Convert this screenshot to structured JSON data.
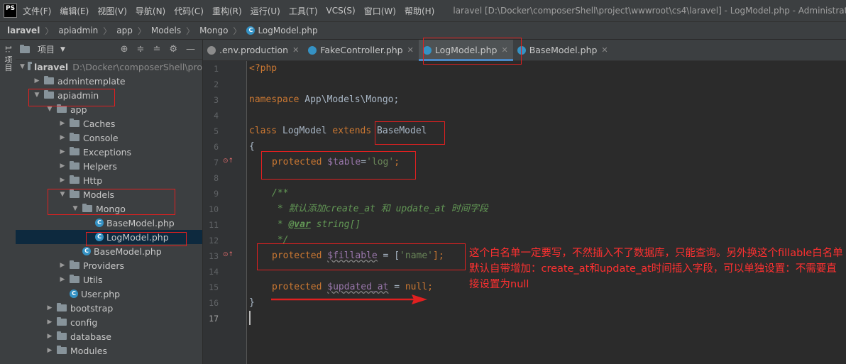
{
  "menubar": {
    "logo": "PS",
    "items": [
      "文件(F)",
      "编辑(E)",
      "视图(V)",
      "导航(N)",
      "代码(C)",
      "重构(R)",
      "运行(U)",
      "工具(T)",
      "VCS(S)",
      "窗口(W)",
      "帮助(H)"
    ],
    "window_title": "laravel [D:\\Docker\\composerShell\\project\\wwwroot\\cs4\\laravel] - LogModel.php - Administrator"
  },
  "breadcrumb": [
    "laravel",
    "apiadmin",
    "app",
    "Models",
    "Mongo",
    "LogModel.php"
  ],
  "left_strip": {
    "tab_label": "1: 项目"
  },
  "project_panel": {
    "title": "项目",
    "root": {
      "name": "laravel",
      "path": "D:\\Docker\\composerShell\\pro"
    },
    "tree": [
      {
        "label": "admintemplate",
        "depth": 1,
        "type": "folder",
        "expanded": false
      },
      {
        "label": "apiadmin",
        "depth": 1,
        "type": "folder",
        "expanded": true
      },
      {
        "label": "app",
        "depth": 2,
        "type": "folder",
        "expanded": true
      },
      {
        "label": "Caches",
        "depth": 3,
        "type": "folder",
        "expanded": false
      },
      {
        "label": "Console",
        "depth": 3,
        "type": "folder",
        "expanded": false
      },
      {
        "label": "Exceptions",
        "depth": 3,
        "type": "folder",
        "expanded": false
      },
      {
        "label": "Helpers",
        "depth": 3,
        "type": "folder",
        "expanded": false
      },
      {
        "label": "Http",
        "depth": 3,
        "type": "folder",
        "expanded": false
      },
      {
        "label": "Models",
        "depth": 3,
        "type": "folder",
        "expanded": true
      },
      {
        "label": "Mongo",
        "depth": 4,
        "type": "folder",
        "expanded": true
      },
      {
        "label": "BaseModel.php",
        "depth": 5,
        "type": "php"
      },
      {
        "label": "LogModel.php",
        "depth": 5,
        "type": "php",
        "selected": true
      },
      {
        "label": "BaseModel.php",
        "depth": 4,
        "type": "php"
      },
      {
        "label": "Providers",
        "depth": 3,
        "type": "folder",
        "expanded": false
      },
      {
        "label": "Utils",
        "depth": 3,
        "type": "folder",
        "expanded": false
      },
      {
        "label": "User.php",
        "depth": 3,
        "type": "php"
      },
      {
        "label": "bootstrap",
        "depth": 2,
        "type": "folder",
        "expanded": false
      },
      {
        "label": "config",
        "depth": 2,
        "type": "folder",
        "expanded": false
      },
      {
        "label": "database",
        "depth": 2,
        "type": "folder",
        "expanded": false
      },
      {
        "label": "Modules",
        "depth": 2,
        "type": "folder",
        "expanded": false
      }
    ]
  },
  "tabs": [
    {
      "label": ".env.production",
      "icon": "env-file-icon",
      "icon_color": "#8c8c8c"
    },
    {
      "label": "FakeController.php",
      "icon": "php-class-icon",
      "icon_color": "#3592c4"
    },
    {
      "label": "LogModel.php",
      "icon": "php-class-icon",
      "icon_color": "#3592c4",
      "active": true
    },
    {
      "label": "BaseModel.php",
      "icon": "php-class-icon",
      "icon_color": "#3592c4"
    }
  ],
  "code": {
    "line_numbers": [
      "1",
      "2",
      "3",
      "4",
      "5",
      "6",
      "7",
      "8",
      "9",
      "10",
      "11",
      "12",
      "13",
      "14",
      "15",
      "16",
      "17"
    ],
    "l1": "<?php",
    "l3_kw": "namespace",
    "l3_rest": " App\\Models\\Mongo;",
    "l5_kw1": "class",
    "l5_name": " LogModel ",
    "l5_kw2": "extends",
    "l5_parent": " BaseModel",
    "l6": "{",
    "l7_kw": "protected",
    "l7_var": "$table",
    "l7_eq": "=",
    "l7_str": "'log'",
    "l7_end": ";",
    "l9": "/**",
    "l10_a": " * 默认添加",
    "l10_b": "create_at",
    "l10_c": " 和 ",
    "l10_d": "update_at",
    "l10_e": " 时间字段",
    "l11_a": " * ",
    "l11_tag": "@var",
    "l11_b": " string[]",
    "l12": " */",
    "l13_kw": "protected",
    "l13_var": "$fillable",
    "l13_eq": " = [",
    "l13_str": "'name'",
    "l13_end": "];",
    "l15_kw": "protected",
    "l15_var": "$updated_at",
    "l15_eq": " = ",
    "l15_null": "null",
    "l15_end": ";",
    "l16": "}"
  },
  "annotation": {
    "text": "这个白名单一定要写，不然插入不了数据库，只能查询。另外换这个fillable白名单默认自带增加：create_at和update_at时间插入字段，可以单独设置：不需要直接设置为null",
    "color": "#ff3030"
  }
}
